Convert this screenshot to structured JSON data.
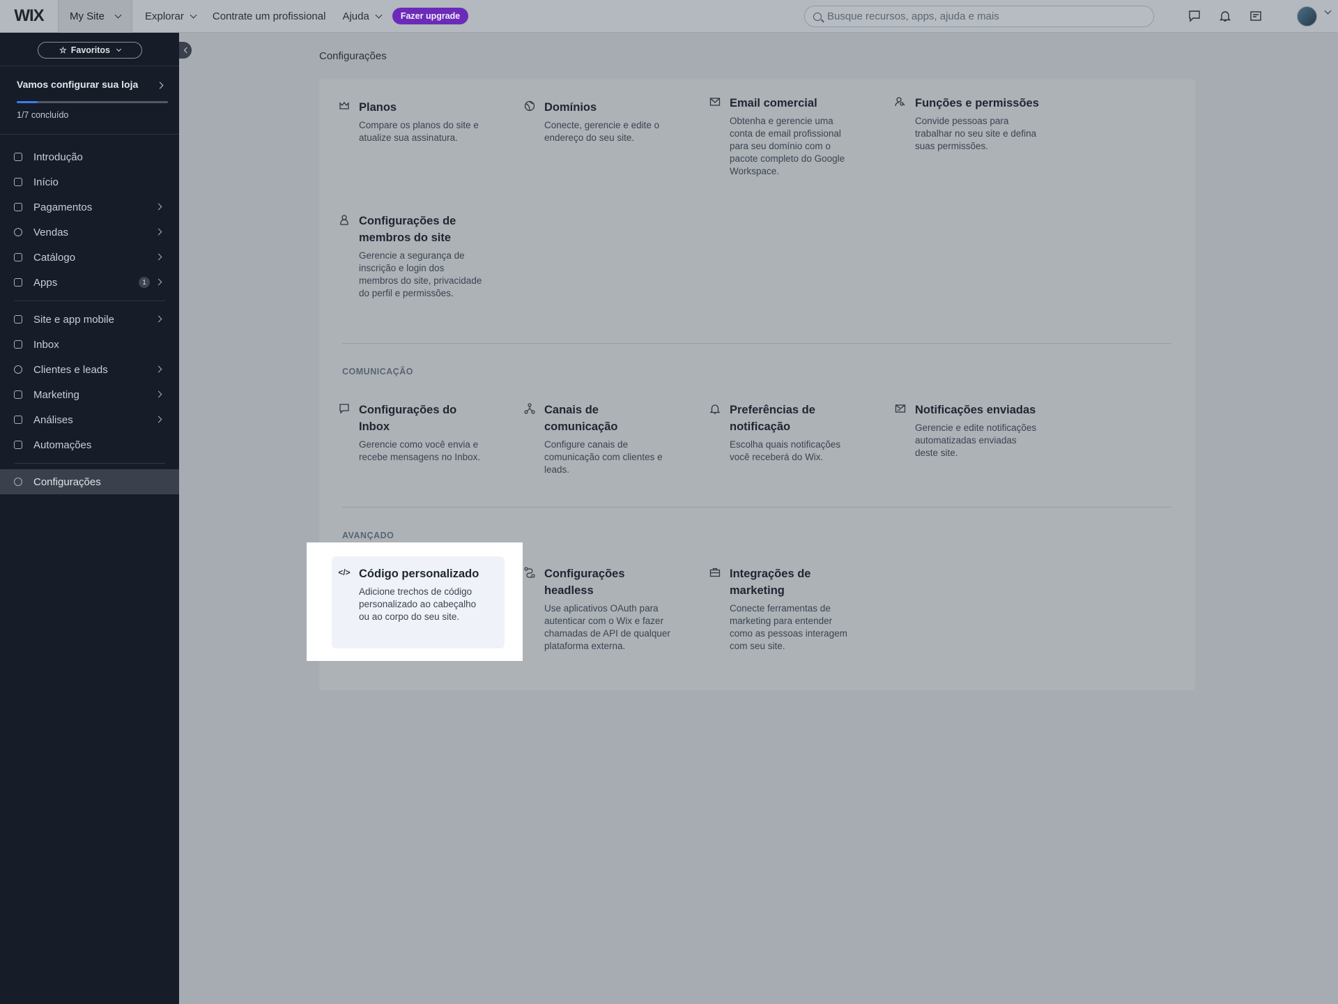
{
  "topbar": {
    "logo": "WIX",
    "site_menu": "My Site",
    "nav": [
      "Explorar",
      "Contrate um profissional",
      "Ajuda"
    ],
    "upgrade": "Fazer upgrade",
    "search_placeholder": "Busque recursos, apps, ajuda e mais"
  },
  "sidebar": {
    "favorites": "Favoritos",
    "setup_title": "Vamos configurar sua loja",
    "setup_progress": "1/7 concluído",
    "setup_progress_fraction": 0.14,
    "items": [
      {
        "label": "Introdução"
      },
      {
        "label": "Início"
      },
      {
        "label": "Pagamentos"
      },
      {
        "label": "Vendas"
      },
      {
        "label": "Catálogo"
      },
      {
        "label": "Apps",
        "badge": "1"
      },
      {
        "label": "Site e app mobile"
      },
      {
        "label": "Inbox"
      },
      {
        "label": "Clientes e leads"
      },
      {
        "label": "Marketing"
      },
      {
        "label": "Análises"
      },
      {
        "label": "Automações"
      },
      {
        "label": "Configurações"
      }
    ]
  },
  "main": {
    "breadcrumb": "Configurações",
    "cards_top": [
      {
        "title": "Planos",
        "desc": "Compare os planos do site e atualize sua assinatura."
      },
      {
        "title": "Domínios",
        "desc": "Conecte, gerencie e edite o endereço do seu site."
      },
      {
        "title": "Email comercial",
        "desc": "Obtenha e gerencie uma conta de email profissional para seu domínio com o pacote completo do Google Workspace."
      },
      {
        "title": "Funções e permissões",
        "desc": "Convide pessoas para trabalhar no seu site e defina suas permissões."
      },
      {
        "title": "Configurações de membros do site",
        "desc": "Gerencie a segurança de inscrição e login dos membros do site, privacidade do perfil e permissões."
      }
    ],
    "section_comm": "COMUNICAÇÃO",
    "cards_comm": [
      {
        "title": "Configurações do Inbox",
        "desc": "Gerencie como você envia e recebe mensagens no Inbox."
      },
      {
        "title": "Canais de comunicação",
        "desc": "Configure canais de comunicação com clientes e leads."
      },
      {
        "title": "Preferências de notificação",
        "desc": "Escolha quais notificações você receberá do Wix."
      },
      {
        "title": "Notificações enviadas",
        "desc": "Gerencie e edite notificações automatizadas enviadas deste site."
      }
    ],
    "section_adv": "AVANÇADO",
    "cards_adv": [
      {
        "title": "Código personalizado",
        "desc": "Adicione trechos de código personalizado ao cabeçalho ou ao corpo do seu site.",
        "icon": "</>"
      },
      {
        "title": "Configurações headless",
        "desc": "Use aplicativos OAuth para autenticar com o Wix e fazer chamadas de API de qualquer plataforma externa."
      },
      {
        "title": "Integrações de marketing",
        "desc": "Conecte ferramentas de marketing para entender como as pessoas interagem com seu site."
      }
    ]
  }
}
